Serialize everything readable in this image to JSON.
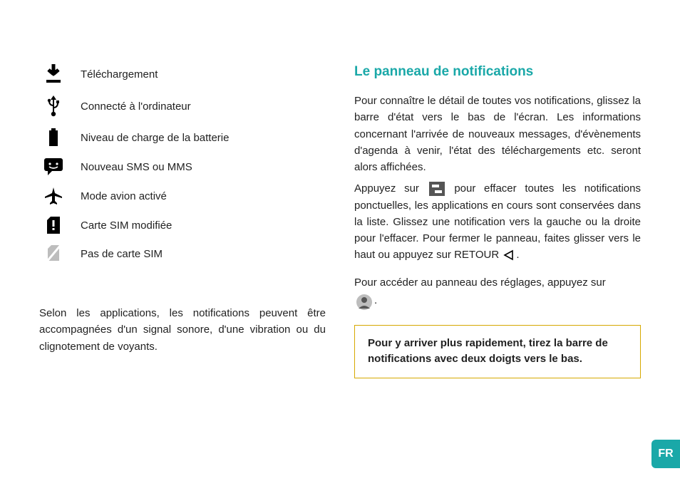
{
  "icons": [
    {
      "label": "Téléchargement"
    },
    {
      "label": "Connecté à l'ordinateur"
    },
    {
      "label": "Niveau de charge de la batterie"
    },
    {
      "label": "Nouveau SMS ou MMS"
    },
    {
      "label": "Mode avion activé"
    },
    {
      "label": "Carte SIM modifiée"
    },
    {
      "label": "Pas de carte SIM"
    }
  ],
  "left_note": "Selon les applications, les notifications peuvent être accompagnées d'un signal sonore, d'une vibration ou du clignotement de voyants.",
  "panel_heading": "Le panneau de notifications",
  "panel_p1": "Pour connaître le détail de toutes vos notifications, glissez la barre d'état vers le bas de l'écran. Les informations concernant l'arrivée de nouveaux messages, d'évènements d'agenda à venir, l'état des téléchargements etc. seront alors affichées.",
  "panel_p2a": "Appuyez sur",
  "panel_p2b": "pour effacer toutes les notifications ponctuelles, les applications en cours sont conservées dans la liste. Glissez une notification vers la gauche ou la droite pour l'effacer. Pour fermer le panneau, faites glisser vers le haut ou appuyez sur RETOUR",
  "panel_p3": "Pour accéder au panneau des réglages, appuyez sur",
  "period": ".",
  "tip": "Pour y arriver plus rapidement, tirez la barre de notifications avec deux doigts vers le bas.",
  "lang": "FR"
}
